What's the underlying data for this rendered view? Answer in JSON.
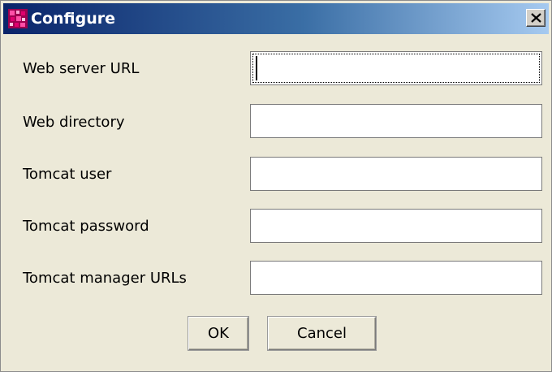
{
  "window": {
    "title": "Configure",
    "close_icon": "close-icon",
    "app_icon": "app-icon"
  },
  "form": {
    "fields": [
      {
        "label": "Web server URL",
        "value": "",
        "focused": true
      },
      {
        "label": "Web directory",
        "value": ""
      },
      {
        "label": "Tomcat user",
        "value": ""
      },
      {
        "label": "Tomcat password",
        "value": ""
      },
      {
        "label": "Tomcat manager URLs",
        "value": ""
      }
    ]
  },
  "buttons": {
    "ok_label": "OK",
    "cancel_label": "Cancel"
  },
  "colors": {
    "title_gradient_start": "#0a246a",
    "title_gradient_end": "#a6caf0",
    "dialog_background": "#ece9d8",
    "icon_accent": "#d6006e"
  }
}
